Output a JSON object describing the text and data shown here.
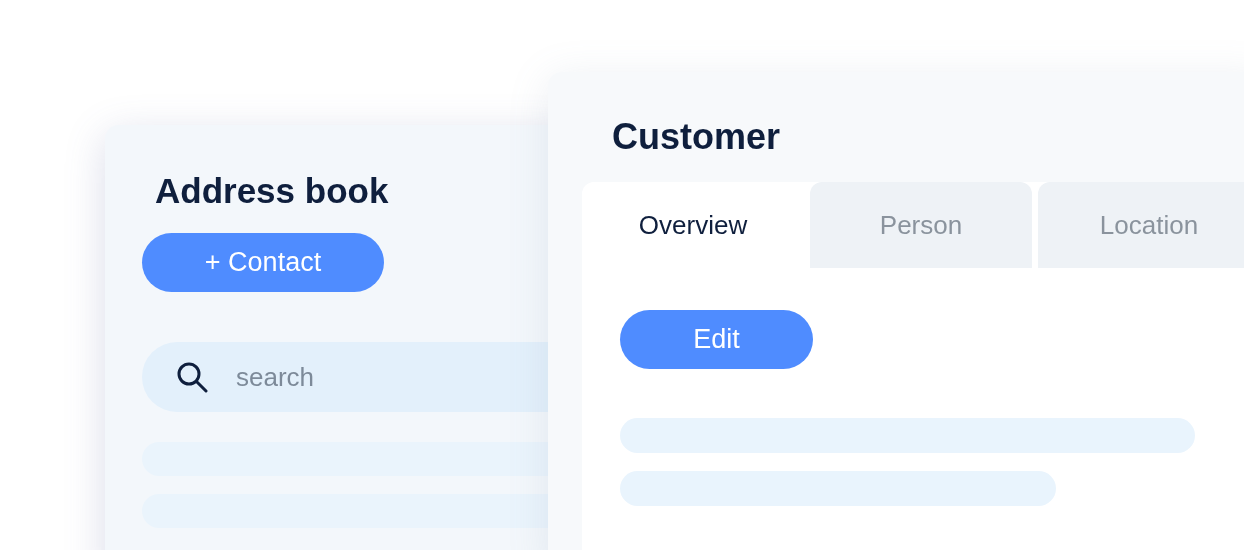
{
  "address_book": {
    "title": "Address book",
    "add_button": "+ Contact",
    "search": {
      "placeholder": "search"
    }
  },
  "customer": {
    "title": "Customer",
    "tabs": [
      {
        "label": "Overview",
        "selected": true
      },
      {
        "label": "Person",
        "selected": false
      },
      {
        "label": "Location",
        "selected": false
      }
    ],
    "edit_button": "Edit"
  }
}
